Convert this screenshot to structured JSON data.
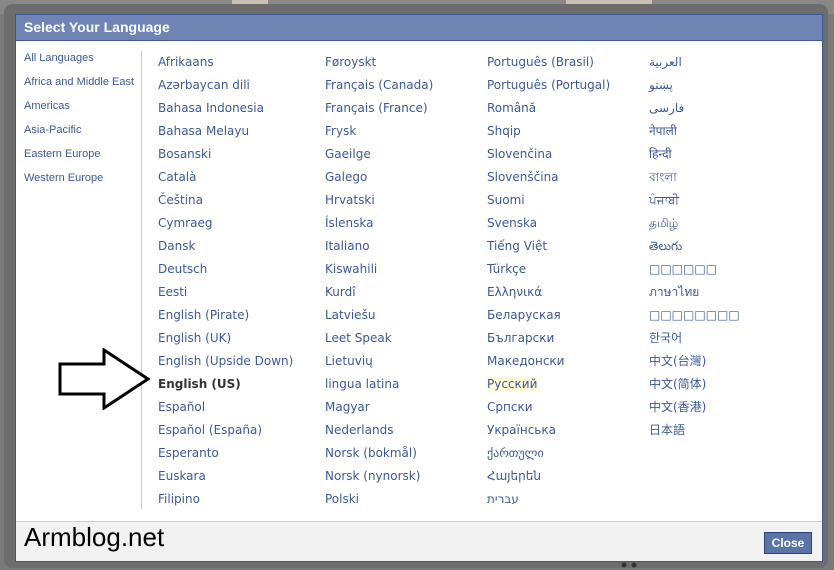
{
  "dialog": {
    "title": "Select Your Language",
    "close_label": "Close"
  },
  "regions": [
    "All Languages",
    "Africa and Middle East",
    "Americas",
    "Asia-Pacific",
    "Eastern Europe",
    "Western Europe"
  ],
  "languages": {
    "col1": [
      "Afrikaans",
      "Azərbaycan dili",
      "Bahasa Indonesia",
      "Bahasa Melayu",
      "Bosanski",
      "Català",
      "Čeština",
      "Cymraeg",
      "Dansk",
      "Deutsch",
      "Eesti",
      "English (Pirate)",
      "English (UK)",
      "English (Upside Down)",
      "English (US)",
      "Español",
      "Español (España)",
      "Esperanto",
      "Euskara",
      "Filipino"
    ],
    "col2": [
      "Føroyskt",
      "Français (Canada)",
      "Français (France)",
      "Frysk",
      "Gaeilge",
      "Galego",
      "Hrvatski",
      "Íslenska",
      "Italiano",
      "Kiswahili",
      "Kurdî",
      "Latviešu",
      "Leet Speak",
      "Lietuvių",
      "lingua latina",
      "Magyar",
      "Nederlands",
      "Norsk (bokmål)",
      "Norsk (nynorsk)",
      "Polski"
    ],
    "col3": [
      "Português (Brasil)",
      "Português (Portugal)",
      "Română",
      "Shqip",
      "Slovenčina",
      "Slovenščina",
      "Suomi",
      "Svenska",
      "Tiếng Việt",
      "Türkçe",
      "Ελληνικά",
      "Беларуская",
      "Български",
      "Македонски",
      "Русский",
      "Српски",
      "Українська",
      "ქართული",
      "Հայերեն",
      "עברית"
    ],
    "col4": [
      "العربية",
      "پښتو",
      "فارسی",
      "नेपाली",
      "हिन्दी",
      "বাংলা",
      "ਪੰਜਾਬੀ",
      "தமிழ்",
      "తెలుగు",
      "□□□□□□",
      "ภาษาไทย",
      "□□□□□□□□",
      "한국어",
      "中文(台灣)",
      "中文(简体)",
      "中文(香港)",
      "日本語"
    ]
  },
  "selected_language": "English (US)",
  "highlighted_language": "Русский",
  "watermark": "Armblog.net",
  "icons": {
    "pointer": "outlined-right-arrow-icon"
  },
  "colors": {
    "title_bar": "#6d84b4",
    "link": "#3b5998",
    "button": "#5b74a8",
    "highlight": "#fff9d7"
  }
}
